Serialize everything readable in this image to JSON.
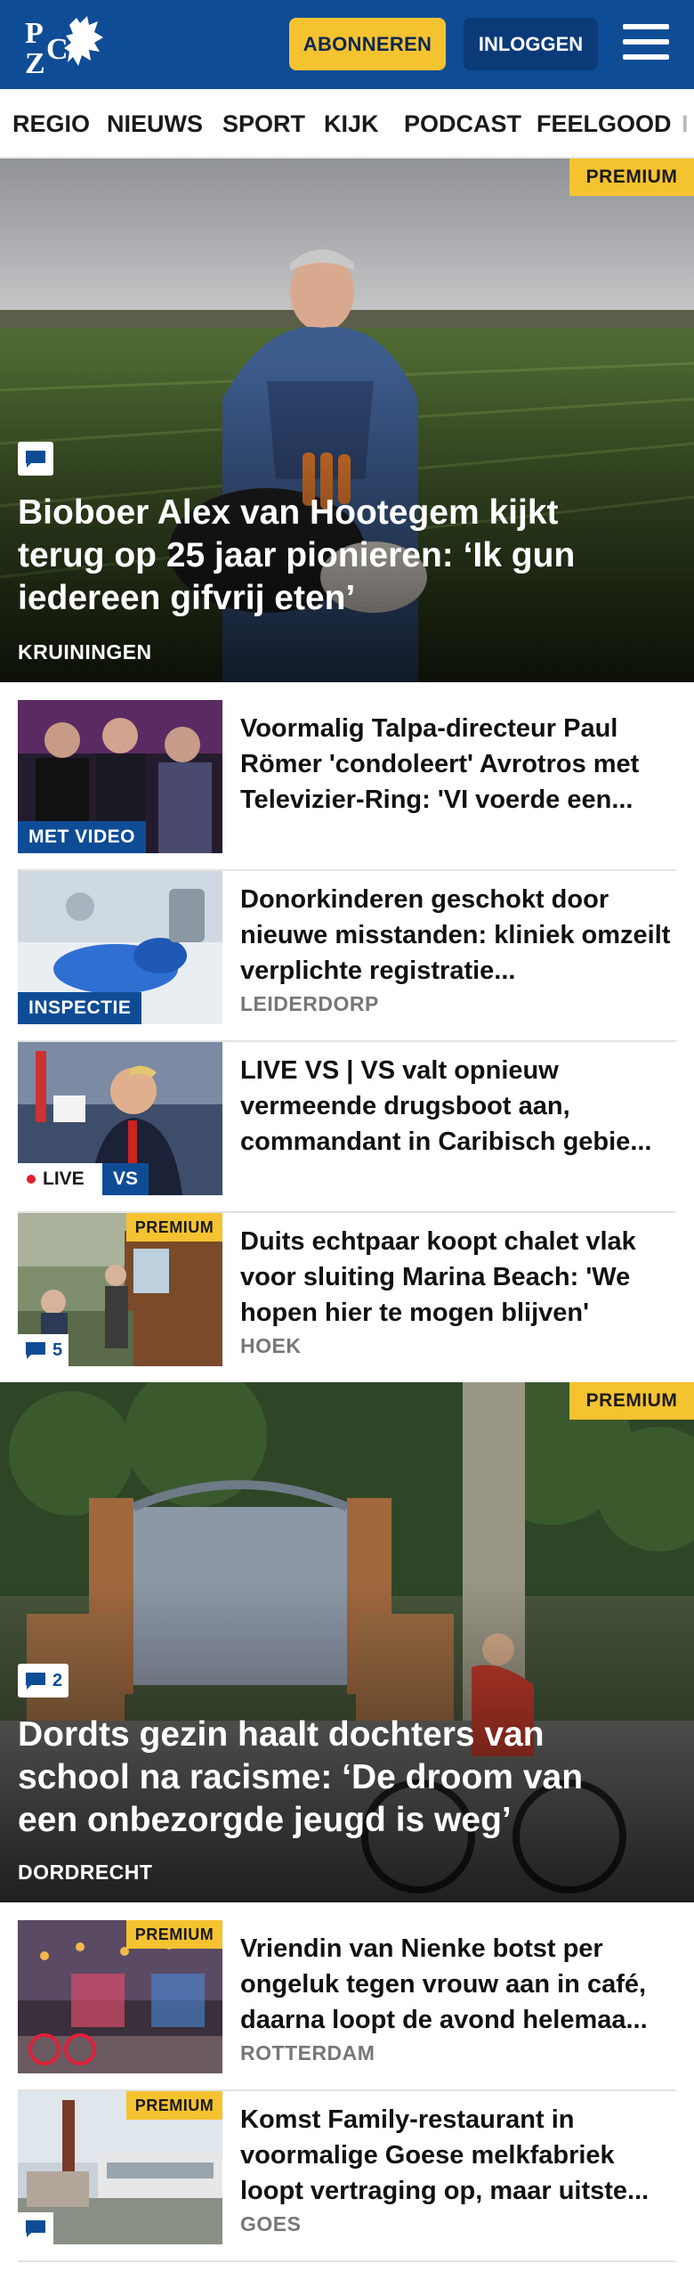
{
  "header": {
    "subscribe_label": "ABONNEREN",
    "login_label": "INLOGGEN",
    "logo_text": "PZC"
  },
  "nav": {
    "items": [
      "REGIO",
      "NIEUWS",
      "SPORT",
      "KIJK",
      "PODCAST",
      "FEELGOOD",
      "I"
    ]
  },
  "articles": [
    {
      "title": "Bioboer Alex van Hootegem kijkt terug op 25 jaar pionieren: ‘Ik gun iedereen gifvrij eten’",
      "location": "KRUININGEN",
      "premium": "PREMIUM",
      "comments": ""
    },
    {
      "title": "Voormalig Talpa-directeur Paul Römer 'condoleert' Avrotros met Televizier-Ring: 'VI voerde een...",
      "label": "MET VIDEO"
    },
    {
      "title": "Donorkinderen geschokt door nieuwe misstanden: kliniek omzeilt verplichte registratie...",
      "location": "LEIDERDORP",
      "label": "INSPECTIE"
    },
    {
      "title": "LIVE VS | VS valt opnieuw vermeende drugsboot aan, commandant in Caribisch gebie...",
      "live_label": "LIVE",
      "topic_label": "VS"
    },
    {
      "title": "Duits echtpaar koopt chalet vlak voor sluiting Marina Beach: 'We hopen hier te mogen blijven'",
      "location": "HOEK",
      "premium": "PREMIUM",
      "comments": "5"
    },
    {
      "title": "Dordts gezin haalt dochters van school na racisme: ‘De droom van een onbezorgde jeugd is weg’",
      "location": "DORDRECHT",
      "premium": "PREMIUM",
      "comments": "2"
    },
    {
      "title": "Vriendin van Nienke botst per ongeluk tegen vrouw aan in café, daarna loopt de avond helemaa...",
      "location": "ROTTERDAM",
      "premium": "PREMIUM"
    },
    {
      "title": "Komst Family-restaurant in voormalige Goese melkfabriek loopt vertraging op, maar uitste...",
      "location": "GOES",
      "premium": "PREMIUM",
      "comments": ""
    }
  ],
  "colors": {
    "brand_blue": "#0f4c96",
    "accent_yellow": "#f5c230",
    "live_red": "#e0202a"
  },
  "icons": [
    "pzc-logo-icon",
    "hamburger-menu-icon",
    "comment-icon",
    "live-dot-icon"
  ]
}
